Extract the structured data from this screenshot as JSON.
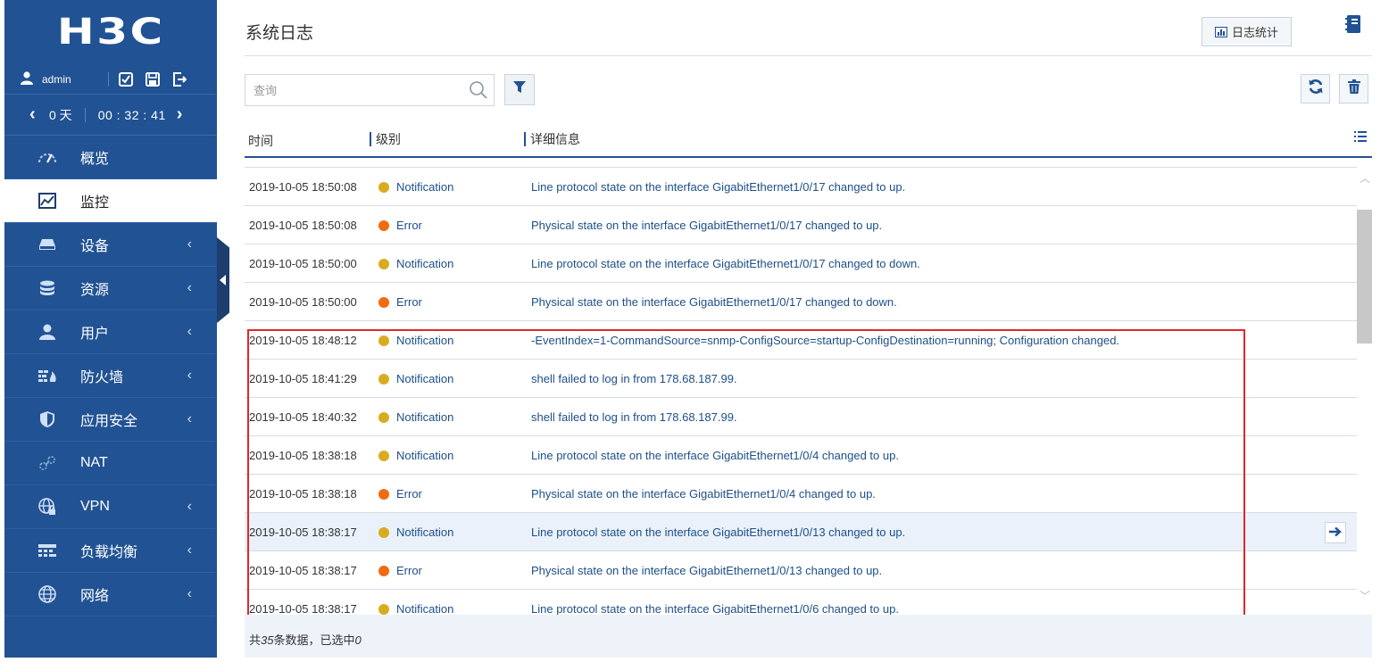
{
  "brand": {
    "logo": "H3C"
  },
  "user": {
    "name": "admin"
  },
  "uptime": {
    "days": "0 天",
    "clock": "00 : 32 : 41"
  },
  "menu": [
    {
      "label": "概览",
      "icon": "speedometer-icon",
      "caret": ""
    },
    {
      "label": "监控",
      "icon": "chart-icon",
      "caret": "",
      "active": true
    },
    {
      "label": "设备",
      "icon": "device-icon",
      "caret": "‹"
    },
    {
      "label": "资源",
      "icon": "database-icon",
      "caret": "‹"
    },
    {
      "label": "用户",
      "icon": "user-icon",
      "caret": "‹"
    },
    {
      "label": "防火墙",
      "icon": "firewall-icon",
      "caret": "‹"
    },
    {
      "label": "应用安全",
      "icon": "shield-icon",
      "caret": "‹"
    },
    {
      "label": "NAT",
      "icon": "link-icon",
      "caret": ""
    },
    {
      "label": "VPN",
      "icon": "globe-lock-icon",
      "caret": "‹"
    },
    {
      "label": "负载均衡",
      "icon": "load-balance-icon",
      "caret": "‹"
    },
    {
      "label": "网络",
      "icon": "globe-icon",
      "caret": "‹"
    }
  ],
  "page": {
    "title": "系统日志",
    "stats_button": "日志统计",
    "search_placeholder": "查询"
  },
  "table": {
    "headers": {
      "time": "时间",
      "level": "级别",
      "detail": "详细信息"
    },
    "rows": [
      {
        "time": "2019-10-05 18:50:08",
        "level": "Notification",
        "detail": "Line protocol state on the interface GigabitEthernet1/0/17 changed to up."
      },
      {
        "time": "2019-10-05 18:50:08",
        "level": "Error",
        "detail": "Physical state on the interface GigabitEthernet1/0/17 changed to up."
      },
      {
        "time": "2019-10-05 18:50:00",
        "level": "Notification",
        "detail": "Line protocol state on the interface GigabitEthernet1/0/17 changed to down."
      },
      {
        "time": "2019-10-05 18:50:00",
        "level": "Error",
        "detail": "Physical state on the interface GigabitEthernet1/0/17 changed to down."
      },
      {
        "time": "2019-10-05 18:48:12",
        "level": "Notification",
        "detail": "-EventIndex=1-CommandSource=snmp-ConfigSource=startup-ConfigDestination=running; Configuration changed."
      },
      {
        "time": "2019-10-05 18:41:29",
        "level": "Notification",
        "detail": "shell failed to log in from 178.68.187.99."
      },
      {
        "time": "2019-10-05 18:40:32",
        "level": "Notification",
        "detail": "shell failed to log in from 178.68.187.99."
      },
      {
        "time": "2019-10-05 18:38:18",
        "level": "Notification",
        "detail": "Line protocol state on the interface GigabitEthernet1/0/4 changed to up."
      },
      {
        "time": "2019-10-05 18:38:18",
        "level": "Error",
        "detail": "Physical state on the interface GigabitEthernet1/0/4 changed to up."
      },
      {
        "time": "2019-10-05 18:38:17",
        "level": "Notification",
        "detail": "Line protocol state on the interface GigabitEthernet1/0/13 changed to up.",
        "highlighted": true
      },
      {
        "time": "2019-10-05 18:38:17",
        "level": "Error",
        "detail": "Physical state on the interface GigabitEthernet1/0/13 changed to up."
      },
      {
        "time": "2019-10-05 18:38:17",
        "level": "Notification",
        "detail": "Line protocol state on the interface GigabitEthernet1/0/6 changed to up."
      }
    ]
  },
  "footer": {
    "prefix": "共",
    "total": "35",
    "middle": "条数据，已选中",
    "selected": "0"
  },
  "colors": {
    "sidebar": "#215293",
    "notification_dot": "#d9ac1f",
    "error_dot": "#f26b11",
    "highlight_box": "#e0282a"
  }
}
